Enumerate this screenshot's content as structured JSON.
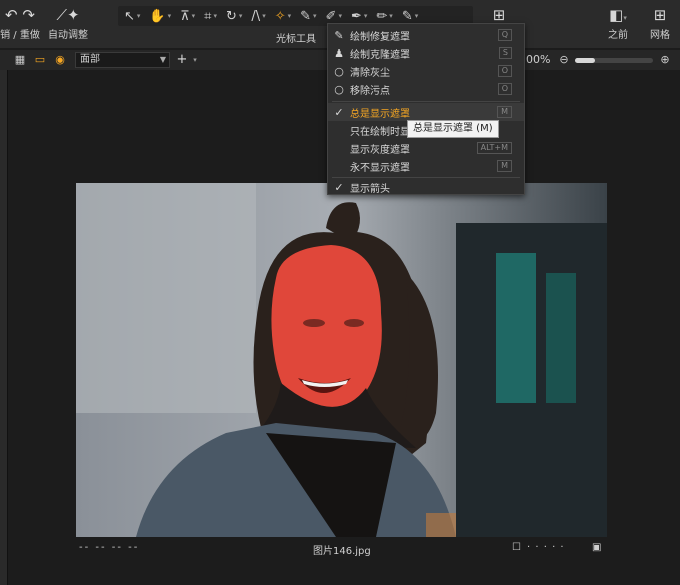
{
  "toolbar": {
    "undo_redo_label": "销 / 重做",
    "auto_adjust_label": "自动调整",
    "cursor_tools_label": "光标工具",
    "before_label": "之前",
    "grid_label": "网格"
  },
  "subbar": {
    "layer_select": "面部",
    "zoom_text": "00%",
    "zoom_level": 0.25
  },
  "menu": {
    "items": [
      {
        "label": "绘制修复遮罩",
        "key": "Q",
        "icon": "brush-icon"
      },
      {
        "label": "绘制克隆遮罩",
        "key": "S",
        "icon": "stamp-icon"
      },
      {
        "label": "清除灰尘",
        "key": "O",
        "icon": "circle-icon"
      },
      {
        "label": "移除污点",
        "key": "O",
        "icon": "circle-icon"
      }
    ],
    "mask_items": [
      {
        "label": "总是显示遮罩",
        "key": "M",
        "checked": true
      },
      {
        "label": "只在绘制时显示遮罩",
        "key": "",
        "checked": false
      },
      {
        "label": "显示灰度遮罩",
        "key": "ALT+M",
        "checked": false
      },
      {
        "label": "永不显示遮罩",
        "key": "M",
        "checked": false
      }
    ],
    "arrow_item": {
      "label": "显示箭头",
      "checked": true
    }
  },
  "tooltip": "总是显示遮罩 (M)",
  "footer": {
    "meta": "-- -- -- --",
    "filename": "图片146.jpg",
    "nav_dots": "· · · · ·"
  },
  "colors": {
    "accent": "#f5a623",
    "mask": "#e0473a"
  }
}
